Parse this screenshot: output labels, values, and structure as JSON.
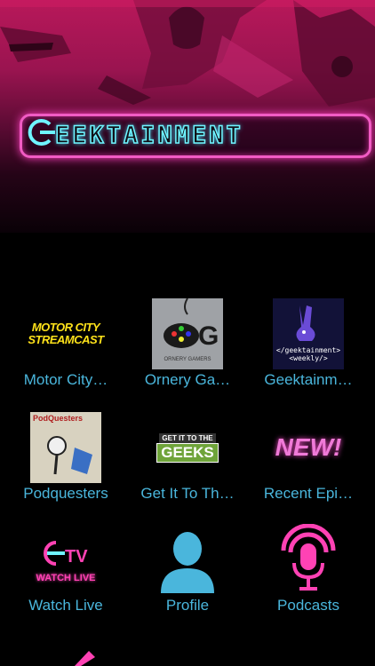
{
  "logo": {
    "text": "EEKTAINMENT"
  },
  "tiles": [
    {
      "label": "Motor City…",
      "thumb_text_1": "MOTOR CITY",
      "thumb_text_2": "STREAMCAST"
    },
    {
      "label": "Ornery Ga…",
      "thumb_text": "ORNERY GAMERS"
    },
    {
      "label": "Geektainm…",
      "thumb_text_1": "</geektainment>",
      "thumb_text_2": "<weekly/>"
    },
    {
      "label": "Podquesters",
      "thumb_text": "PodQuesters"
    },
    {
      "label": "Get It To Th…",
      "thumb_text_1": "GET IT TO THE",
      "thumb_text_2": "GEEKS"
    },
    {
      "label": "Recent Epi…",
      "thumb_text": "NEW!"
    },
    {
      "label": "Watch Live",
      "thumb_text": "WATCH LIVE"
    },
    {
      "label": "Profile"
    },
    {
      "label": "Podcasts"
    }
  ],
  "icons": {
    "profile": "person-icon",
    "podcasts": "microphone-icon",
    "edit": "pencil-icon"
  },
  "colors": {
    "label": "#4ab6dc",
    "accent_pink": "#f15bc4",
    "accent_cyan": "#6ff4ff"
  }
}
